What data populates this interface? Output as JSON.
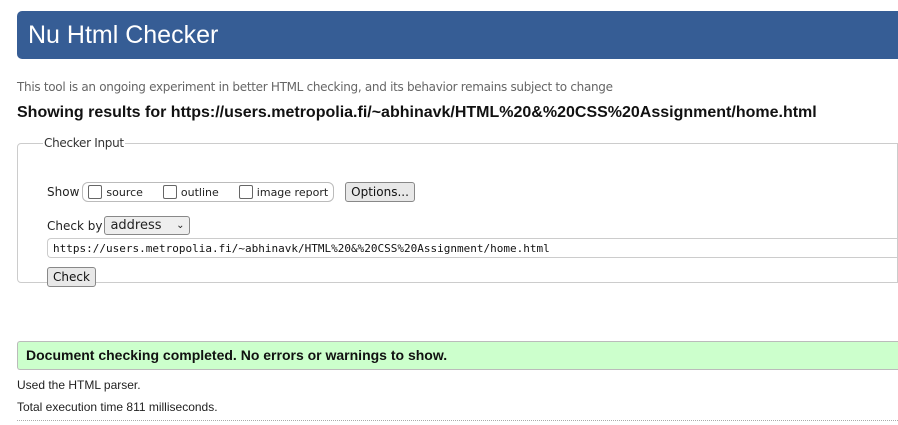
{
  "header": {
    "title": "Nu Html Checker"
  },
  "intro": "This tool is an ongoing experiment in better HTML checking, and its behavior remains subject to change",
  "showing": "Showing results for https://users.metropolia.fi/~abhinavk/HTML%20&%20CSS%20Assignment/home.html",
  "checker": {
    "legend": "Checker Input",
    "show_label": "Show",
    "options": [
      {
        "label": "source",
        "checked": false
      },
      {
        "label": "outline",
        "checked": false
      },
      {
        "label": "image report",
        "checked": false
      }
    ],
    "options_button": "Options...",
    "check_by_label": "Check by",
    "check_by_value": "address",
    "url_value": "https://users.metropolia.fi/~abhinavk/HTML%20&%20CSS%20Assignment/home.html",
    "check_button": "Check"
  },
  "result": {
    "message": "Document checking completed. No errors or warnings to show.",
    "parser": "Used the HTML parser.",
    "time": "Total execution time 811 milliseconds."
  }
}
